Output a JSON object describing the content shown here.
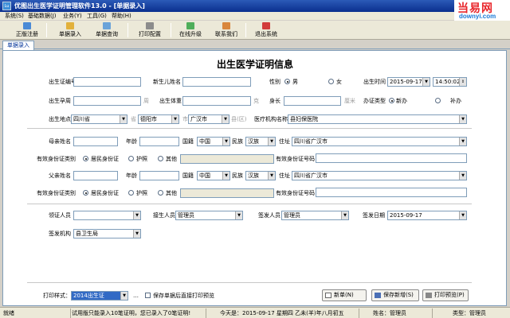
{
  "window": {
    "title": "优图出生医学证明管理软件13.0 - [单据录入]",
    "app_icon": "Lu"
  },
  "watermark": {
    "top": "当易网",
    "bottom": "downyi.com"
  },
  "menu": [
    "系统(S)",
    "基础数据(J)",
    "业务(Y)",
    "工具(G)",
    "帮助(H)"
  ],
  "toolbar": [
    "正版注册",
    "单据录入",
    "单据查询",
    "打印配置",
    "在线升级",
    "联系我们",
    "退出系统"
  ],
  "tab": "单据录入",
  "form": {
    "title": "出生医学证明信息",
    "labels": {
      "cert_no": "出生证编号",
      "baby_name": "新生儿姓名",
      "gender": "性别",
      "birth_time": "出生时间",
      "gest_weeks": "出生孕周",
      "weight": "出生体重",
      "height": "身长",
      "handle_type": "办证类型",
      "birth_place": "出生地点",
      "institution": "医疗机构名称",
      "mother_name": "母亲姓名",
      "age": "年龄",
      "nationality": "国籍",
      "ethnicity": "民族",
      "address": "住址",
      "id_type": "有效身份证类别",
      "id_no": "有效身份证号码",
      "father_name": "父亲姓名",
      "receiver": "领证人员",
      "recorder": "接生人员",
      "issuer": "签发人员",
      "issue_date": "签发日期",
      "issue_org": "签发机构"
    },
    "units": {
      "week": "周",
      "gram": "克",
      "cm": "厘米",
      "sheng": "省",
      "shi": "市",
      "xian": "县(区)"
    },
    "gender_options": [
      "男",
      "女"
    ],
    "gender_selected": "男",
    "birth_date": "2015-09-17",
    "birth_clock": "14:50:02",
    "handle_options": [
      "新办",
      "补办"
    ],
    "handle_selected": "新办",
    "province": "四川省",
    "city": "德阳市",
    "county": "广汉市",
    "institution_value": "县妇保医院",
    "mother": {
      "nationality": "中国",
      "ethnicity": "汉族",
      "address": "四川省广汉市"
    },
    "father": {
      "nationality": "中国",
      "ethnicity": "汉族",
      "address": "四川省广汉市"
    },
    "id_options": [
      "居民身份证",
      "护照",
      "其他"
    ],
    "id_selected": "居民身份证",
    "recorder_value": "管理员",
    "issuer_value": "管理员",
    "issue_date_value": "2015-09-17",
    "issue_org_value": "县卫生局"
  },
  "bottom": {
    "print_label": "打印样式：",
    "print_value": "2014出生证",
    "ellipsis": "…",
    "preview_checkbox": "保存单据后直接打印预览",
    "buttons": [
      "新单(N)",
      "保存新增(S)",
      "打印预览(P)"
    ]
  },
  "status": {
    "ready": "就绪",
    "trial": "试用版只能录入10笔证明，您已录入了0笔证明!",
    "today": "今天是：2015-09-17  星期四  乙未(羊)年八月初五",
    "user": "姓名：管理员",
    "role": "类型：管理员"
  }
}
